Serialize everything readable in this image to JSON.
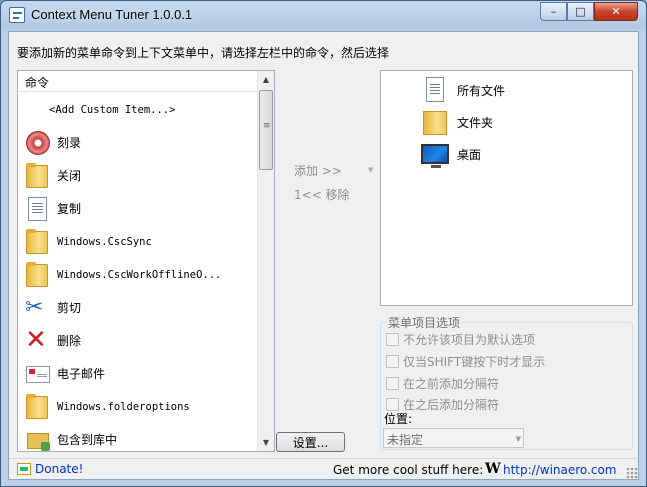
{
  "window": {
    "title": "Context Menu Tuner 1.0.0.1",
    "caption": {
      "minimize": "–",
      "maximize": "□",
      "close": "✕"
    }
  },
  "instruction": "要添加新的菜单命令到上下文菜单中，请选择左栏中的命令，然后选择",
  "commands": {
    "header": "命令",
    "items": [
      {
        "label": "<Add Custom Item...>",
        "icon": "none"
      },
      {
        "label": "刻录",
        "icon": "burn-disc-icon"
      },
      {
        "label": "关闭",
        "icon": "folder-icon"
      },
      {
        "label": "复制",
        "icon": "document-icon"
      },
      {
        "label": "Windows.CscSync",
        "icon": "folder-icon"
      },
      {
        "label": "Windows.CscWorkOfflineO...",
        "icon": "folder-icon"
      },
      {
        "label": "剪切",
        "icon": "scissors-icon"
      },
      {
        "label": "删除",
        "icon": "delete-x-icon"
      },
      {
        "label": "电子邮件",
        "icon": "envelope-icon"
      },
      {
        "label": "Windows.folderoptions",
        "icon": "folder-icon"
      },
      {
        "label": "包含到库中",
        "icon": "library-icon"
      }
    ]
  },
  "actions": {
    "add": "添加 >>",
    "remove": "1<< 移除"
  },
  "targets": {
    "items": [
      {
        "label": "所有文件",
        "icon": "all-files-icon"
      },
      {
        "label": "文件夹",
        "icon": "folder-icon"
      },
      {
        "label": "桌面",
        "icon": "desktop-icon"
      }
    ]
  },
  "options": {
    "title": "菜单项目选项",
    "checkboxes": [
      "不允许该项目为默认选项",
      "仅当SHIFT键按下时才显示",
      "在之前添加分隔符",
      "在之后添加分隔符"
    ],
    "position_label": "位置:",
    "position_value": "未指定"
  },
  "settings_button": "设置...",
  "status": {
    "donate": "Donate!",
    "more": "Get more cool stuff here:",
    "logo": "W",
    "link": "http://winaero.com"
  }
}
